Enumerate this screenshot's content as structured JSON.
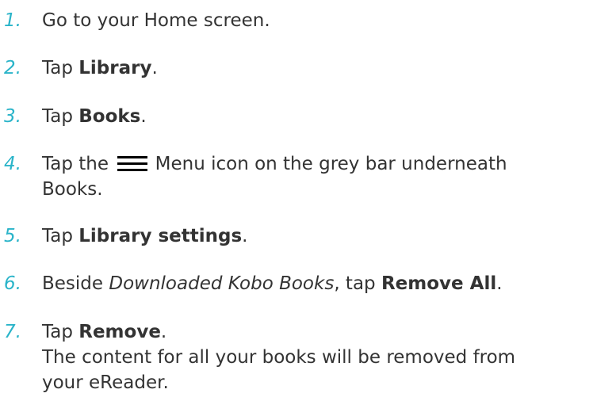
{
  "steps": [
    {
      "number": "1.",
      "text": "Go to your Home screen."
    },
    {
      "number": "2.",
      "pre": "Tap ",
      "bold": "Library",
      "post": "."
    },
    {
      "number": "3.",
      "pre": "Tap ",
      "bold": "Books",
      "post": "."
    },
    {
      "number": "4.",
      "pre": "Tap the ",
      "icon": "menu-icon",
      "post": " Menu icon on the grey bar underneath",
      "line2": "Books."
    },
    {
      "number": "5.",
      "pre": "Tap ",
      "bold": "Library settings",
      "post": "."
    },
    {
      "number": "6.",
      "pre": "Beside ",
      "italic": "Downloaded Kobo Books",
      "mid": ", tap ",
      "bold": "Remove All",
      "post": "."
    },
    {
      "number": "7.",
      "pre": "Tap ",
      "bold": "Remove",
      "post": ".",
      "line2": "The content for all your books will be removed from",
      "line3": "your eReader."
    }
  ],
  "colors": {
    "step_number": "#2ab4c9",
    "text": "#333333",
    "icon": "#000000"
  }
}
